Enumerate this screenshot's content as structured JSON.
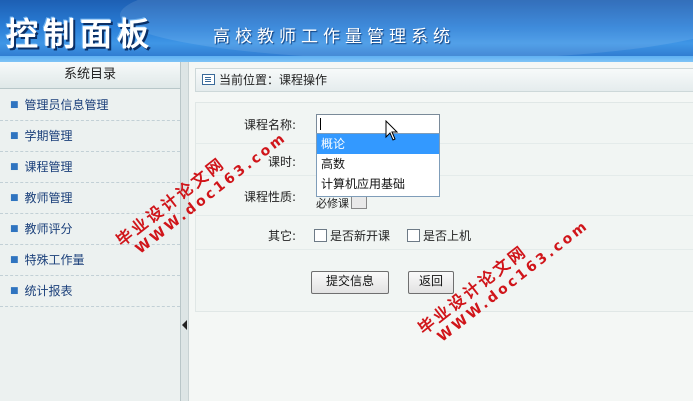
{
  "header": {
    "title": "控制面板",
    "subtitle": "高校教师工作量管理系统"
  },
  "sidebar": {
    "title": "系统目录",
    "items": [
      {
        "label": "管理员信息管理"
      },
      {
        "label": "学期管理"
      },
      {
        "label": "课程管理"
      },
      {
        "label": "教师管理"
      },
      {
        "label": "教师评分"
      },
      {
        "label": "特殊工作量"
      },
      {
        "label": "统计报表"
      }
    ]
  },
  "breadcrumb": {
    "text": "当前位置：课程操作"
  },
  "form": {
    "course_name_label": "课程名称:",
    "course_name_value": "",
    "course_options": [
      "概论",
      "高数",
      "计算机应用基础"
    ],
    "selected_option": "概论",
    "hours_label": "课时:",
    "type_label": "课程性质:",
    "type_partial_text": "必修课",
    "other_label": "其它:",
    "checkbox_new_course": "是否新开课",
    "checkbox_lab": "是否上机",
    "submit_label": "提交信息",
    "reset_label": "返回"
  },
  "watermark": {
    "line1": "毕业设计论文网",
    "line2": "WWW.doc163.com"
  },
  "colors": {
    "header_blue": "#2a7fd8",
    "selection_blue": "#3399ff",
    "watermark_red": "#d0151a"
  }
}
